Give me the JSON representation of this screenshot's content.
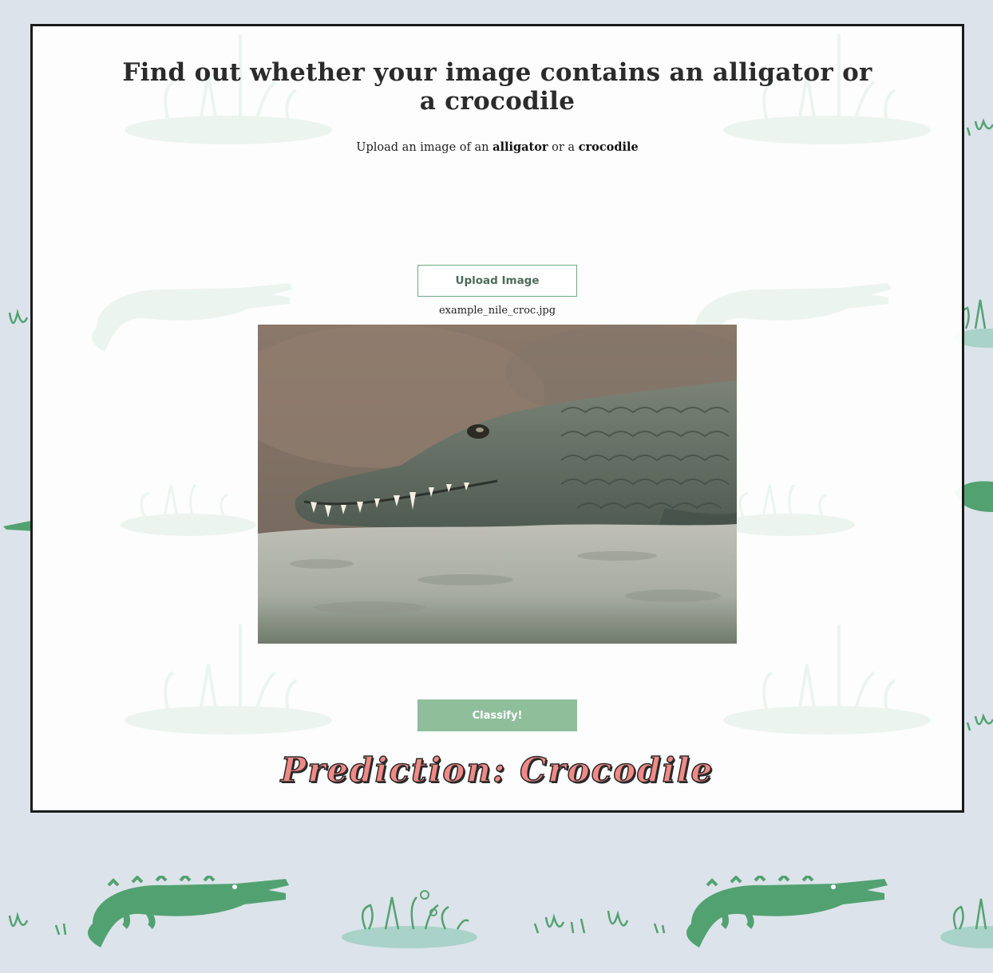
{
  "header": {
    "title": "Find out whether your image contains an alligator or a crocodile",
    "subtitle_prefix": "Upload an image of an",
    "subtitle_word1": "alligator",
    "subtitle_middle": "or a",
    "subtitle_word2": "crocodile"
  },
  "upload": {
    "button_label": "Upload Image",
    "filename": "example_nile_croc.jpg"
  },
  "preview": {
    "icon": "crocodile-photo"
  },
  "actions": {
    "classify_label": "Classify!"
  },
  "result": {
    "prediction_text": "Prediction: Crocodile"
  },
  "colors": {
    "background": "#dce3ea",
    "accent_green": "#52a271",
    "button_green": "#8fbe9b",
    "prediction_pink": "#f08a86"
  }
}
